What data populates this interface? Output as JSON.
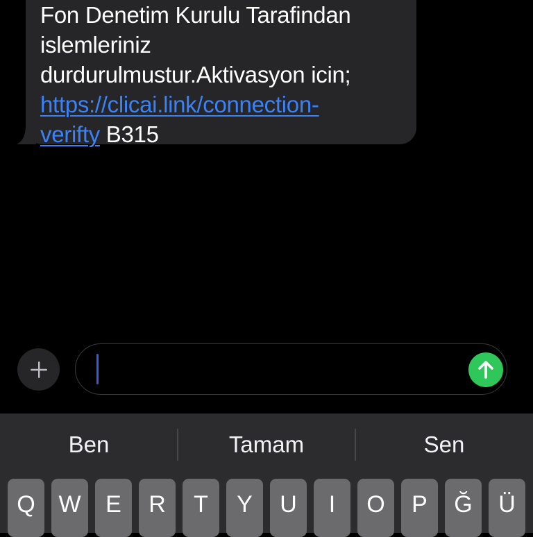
{
  "conversation": {
    "message": {
      "lines": [
        "Fon Denetim Kurulu Tarafindan",
        "islemleriniz",
        "durdurulmustur.Aktivasyon icin;"
      ],
      "link_part1": "https://clicai.link/connection-",
      "link_part2": "verifty",
      "trailing_text": " B315"
    }
  },
  "composer": {
    "plus_icon": "plus-icon",
    "send_icon": "arrow-up-icon",
    "text_value": "",
    "send_color": "#30c75a"
  },
  "keyboard": {
    "suggestions": [
      "Ben",
      "Tamam",
      "Sen"
    ],
    "keys": [
      "Q",
      "W",
      "E",
      "R",
      "T",
      "Y",
      "U",
      "I",
      "O",
      "P",
      "Ğ",
      "Ü"
    ]
  },
  "colors": {
    "bubble": "#262628",
    "link": "#3b82f7",
    "keyboard_bg": "#2c2c2e",
    "key_bg": "#6b6b6e"
  }
}
